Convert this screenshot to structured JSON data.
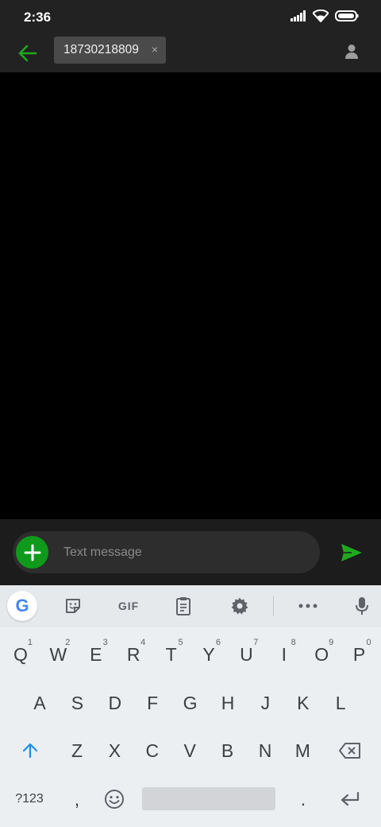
{
  "status_bar": {
    "time": "2:36"
  },
  "app_bar": {
    "recipient": "18730218809",
    "chip_close": "×"
  },
  "compose": {
    "placeholder": "Text message"
  },
  "keyboard": {
    "toolbar": {
      "google": "G",
      "gif": "GIF"
    },
    "row1": [
      {
        "key": "Q",
        "hint": "1"
      },
      {
        "key": "W",
        "hint": "2"
      },
      {
        "key": "E",
        "hint": "3"
      },
      {
        "key": "R",
        "hint": "4"
      },
      {
        "key": "T",
        "hint": "5"
      },
      {
        "key": "Y",
        "hint": "6"
      },
      {
        "key": "U",
        "hint": "7"
      },
      {
        "key": "I",
        "hint": "8"
      },
      {
        "key": "O",
        "hint": "9"
      },
      {
        "key": "P",
        "hint": "0"
      }
    ],
    "row2": [
      "A",
      "S",
      "D",
      "F",
      "G",
      "H",
      "J",
      "K",
      "L"
    ],
    "row3": [
      "Z",
      "X",
      "C",
      "V",
      "B",
      "N",
      "M"
    ],
    "row4": {
      "symbols": "?123",
      "comma": ",",
      "period": "."
    }
  },
  "colors": {
    "accent_green": "#0f9a1c",
    "shift_blue": "#1a8fe3"
  }
}
